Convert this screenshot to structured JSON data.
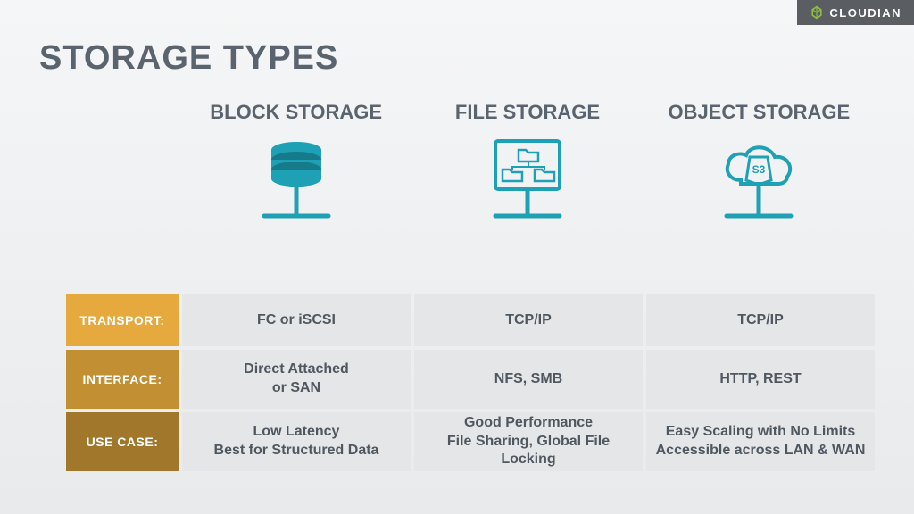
{
  "brand": {
    "name": "CLOUDIAN",
    "accent_color": "#8fbf3f"
  },
  "page_title": "STORAGE TYPES",
  "icon_color": "#1ea0b5",
  "columns": [
    {
      "title": "BLOCK\nSTORAGE",
      "icon": "database"
    },
    {
      "title": "FILE\nSTORAGE",
      "icon": "monitor-folders"
    },
    {
      "title": "OBJECT\nSTORAGE",
      "icon": "cloud-s3",
      "badge": "S3"
    }
  ],
  "rows": [
    {
      "label": "TRANSPORT:",
      "label_color": "#e5a93e",
      "cells": [
        "FC or iSCSI",
        "TCP/IP",
        "TCP/IP"
      ]
    },
    {
      "label": "INTERFACE:",
      "label_color": "#c28f33",
      "cells": [
        "Direct Attached\nor SAN",
        "NFS, SMB",
        "HTTP, REST"
      ]
    },
    {
      "label": "USE CASE:",
      "label_color": "#a1772b",
      "cells": [
        "Low Latency\nBest for Structured Data",
        "Good Performance\nFile Sharing, Global File Locking",
        "Easy Scaling with No Limits\nAccessible across LAN & WAN"
      ]
    }
  ]
}
